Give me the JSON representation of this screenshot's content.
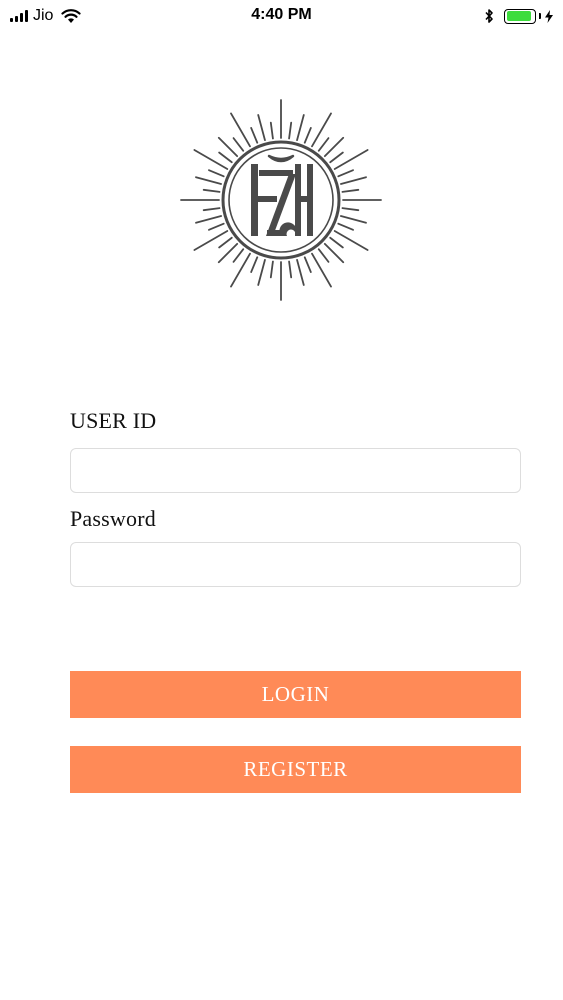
{
  "status_bar": {
    "carrier": "Jio",
    "time": "4:40 PM",
    "battery_level": 0.95,
    "battery_color": "#3ddc3d"
  },
  "logo": {
    "icon": "sunburst-monogram-logo",
    "color": "#4a4a4a"
  },
  "form": {
    "user_id_label": "USER ID",
    "user_id_value": "",
    "password_label": "Password",
    "password_value": ""
  },
  "buttons": {
    "login_label": "LOGIN",
    "register_label": "REGISTER",
    "accent_color": "#ff8a57"
  }
}
